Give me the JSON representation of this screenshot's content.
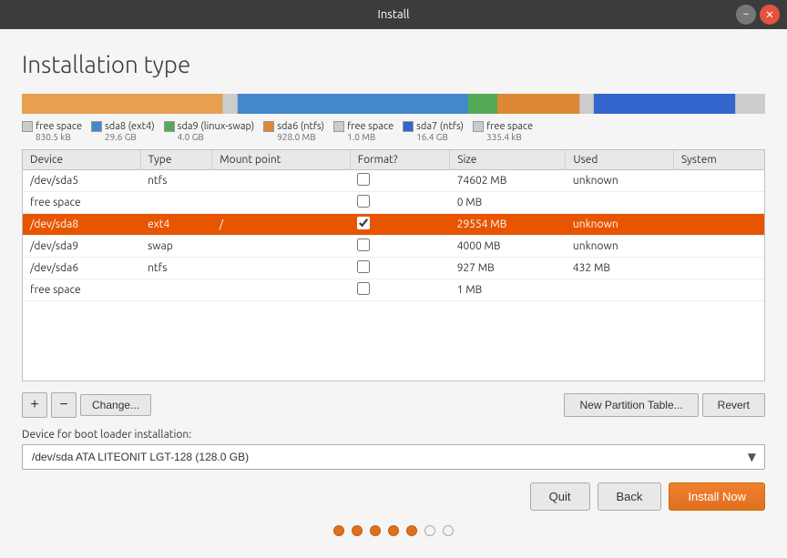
{
  "window": {
    "title": "Install",
    "minimize_label": "−",
    "close_label": "✕"
  },
  "page": {
    "title": "Installation type"
  },
  "partition_bar": {
    "segments": [
      {
        "color": "#e8a050",
        "width": "27%"
      },
      {
        "color": "#cccccc",
        "width": "2%"
      },
      {
        "color": "#4488cc",
        "width": "31%"
      },
      {
        "color": "#55aa55",
        "width": "4%"
      },
      {
        "color": "#dd8833",
        "width": "11%"
      },
      {
        "color": "#cccccc",
        "width": "2%"
      },
      {
        "color": "#3366cc",
        "width": "19%"
      },
      {
        "color": "#cccccc",
        "width": "4%"
      }
    ]
  },
  "partition_legend": [
    {
      "label": "free space",
      "size": "830.5 kB",
      "color": "#cccccc",
      "bordered": true
    },
    {
      "label": "sda8 (ext4)",
      "size": "29.6 GB",
      "color": "#4488cc",
      "bordered": false
    },
    {
      "label": "sda9 (linux-swap)",
      "size": "4.0 GB",
      "color": "#55aa55",
      "bordered": false
    },
    {
      "label": "sda6 (ntfs)",
      "size": "928.0 MB",
      "color": "#dd8833",
      "bordered": false
    },
    {
      "label": "free space",
      "size": "1.0 MB",
      "color": "#cccccc",
      "bordered": true
    },
    {
      "label": "sda7 (ntfs)",
      "size": "16.4 GB",
      "color": "#3366cc",
      "bordered": false
    },
    {
      "label": "free space",
      "size": "335.4 kB",
      "color": "#cccccc",
      "bordered": true
    }
  ],
  "table": {
    "headers": [
      "Device",
      "Type",
      "Mount point",
      "Format?",
      "Size",
      "Used",
      "System"
    ],
    "rows": [
      {
        "device": "/dev/sda5",
        "type": "ntfs",
        "mount": "",
        "format": false,
        "size": "74602 MB",
        "used": "unknown",
        "system": "",
        "selected": false
      },
      {
        "device": "free space",
        "type": "",
        "mount": "",
        "format": false,
        "size": "0 MB",
        "used": "",
        "system": "",
        "selected": false
      },
      {
        "device": "/dev/sda8",
        "type": "ext4",
        "mount": "/",
        "format": true,
        "size": "29554 MB",
        "used": "unknown",
        "system": "",
        "selected": true
      },
      {
        "device": "/dev/sda9",
        "type": "swap",
        "mount": "",
        "format": false,
        "size": "4000 MB",
        "used": "unknown",
        "system": "",
        "selected": false
      },
      {
        "device": "/dev/sda6",
        "type": "ntfs",
        "mount": "",
        "format": false,
        "size": "927 MB",
        "used": "432 MB",
        "system": "",
        "selected": false
      },
      {
        "device": "free space",
        "type": "",
        "mount": "",
        "format": false,
        "size": "1 MB",
        "used": "",
        "system": "",
        "selected": false
      }
    ]
  },
  "controls": {
    "add_label": "+",
    "remove_label": "−",
    "change_label": "Change...",
    "new_partition_table_label": "New Partition Table...",
    "revert_label": "Revert"
  },
  "bootloader": {
    "label": "Device for boot loader installation:",
    "value": "/dev/sda   ATA LITEONIT LGT-128 (128.0 GB)",
    "placeholder": "/dev/sda   ATA LITEONIT LGT-128 (128.0 GB)"
  },
  "nav": {
    "quit_label": "Quit",
    "back_label": "Back",
    "install_label": "Install Now"
  },
  "progress": {
    "total": 7,
    "filled": 5
  }
}
